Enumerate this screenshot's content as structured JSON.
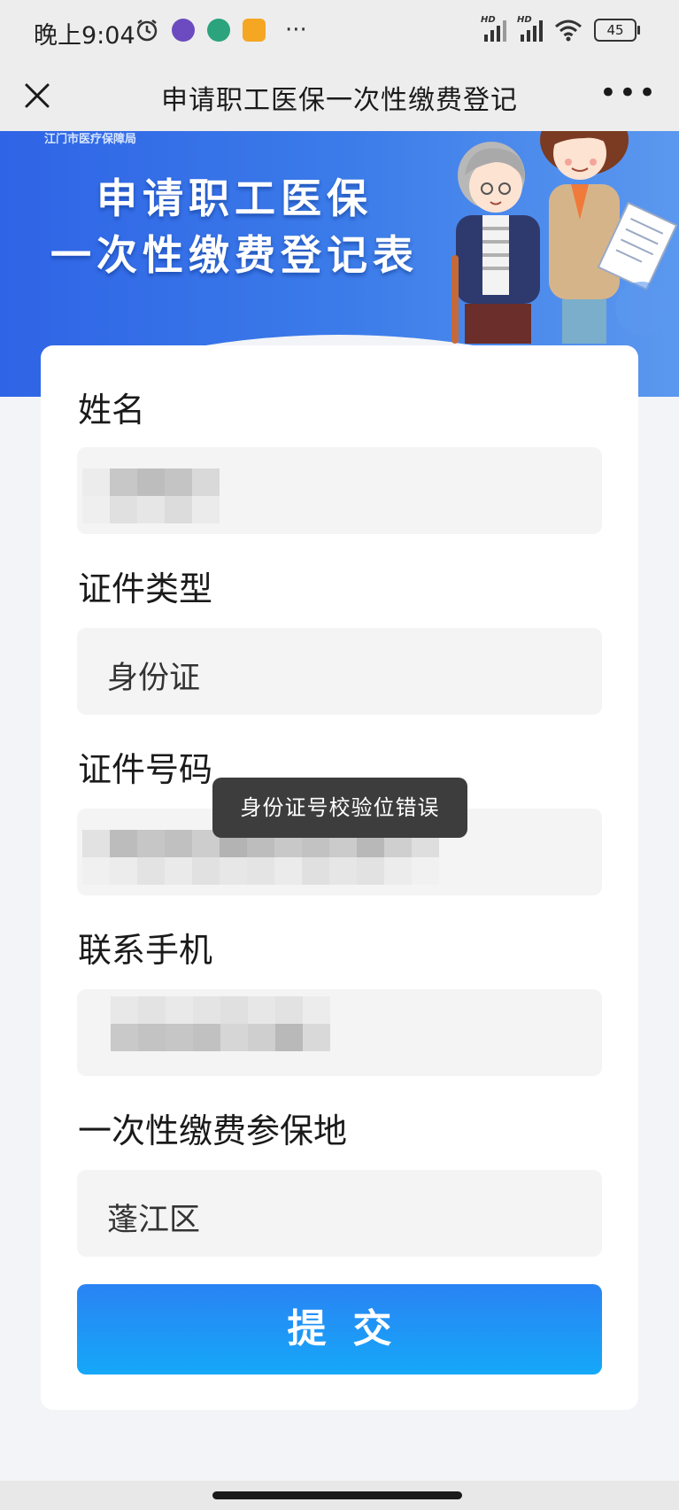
{
  "status_bar": {
    "time": "晚上9:04",
    "signal_tag_1": "HD",
    "signal_tag_2": "HD",
    "battery": "45"
  },
  "nav": {
    "title": "申请职工医保一次性缴费登记"
  },
  "banner": {
    "org": "江门市医疗保障局",
    "title_line1": "申请职工医保",
    "title_line2": "一次性缴费登记表"
  },
  "form": {
    "name_label": "姓名",
    "id_type_label": "证件类型",
    "id_type_value": "身份证",
    "id_number_label": "证件号码",
    "phone_label": "联系手机",
    "insurance_place_label": "一次性缴费参保地",
    "insurance_place_value": "蓬江区",
    "submit_label": "提交"
  },
  "toast": {
    "message": "身份证号校验位错误"
  },
  "colors": {
    "primary_blue": "#2a83f4",
    "banner_blue": "#3b7be9"
  }
}
